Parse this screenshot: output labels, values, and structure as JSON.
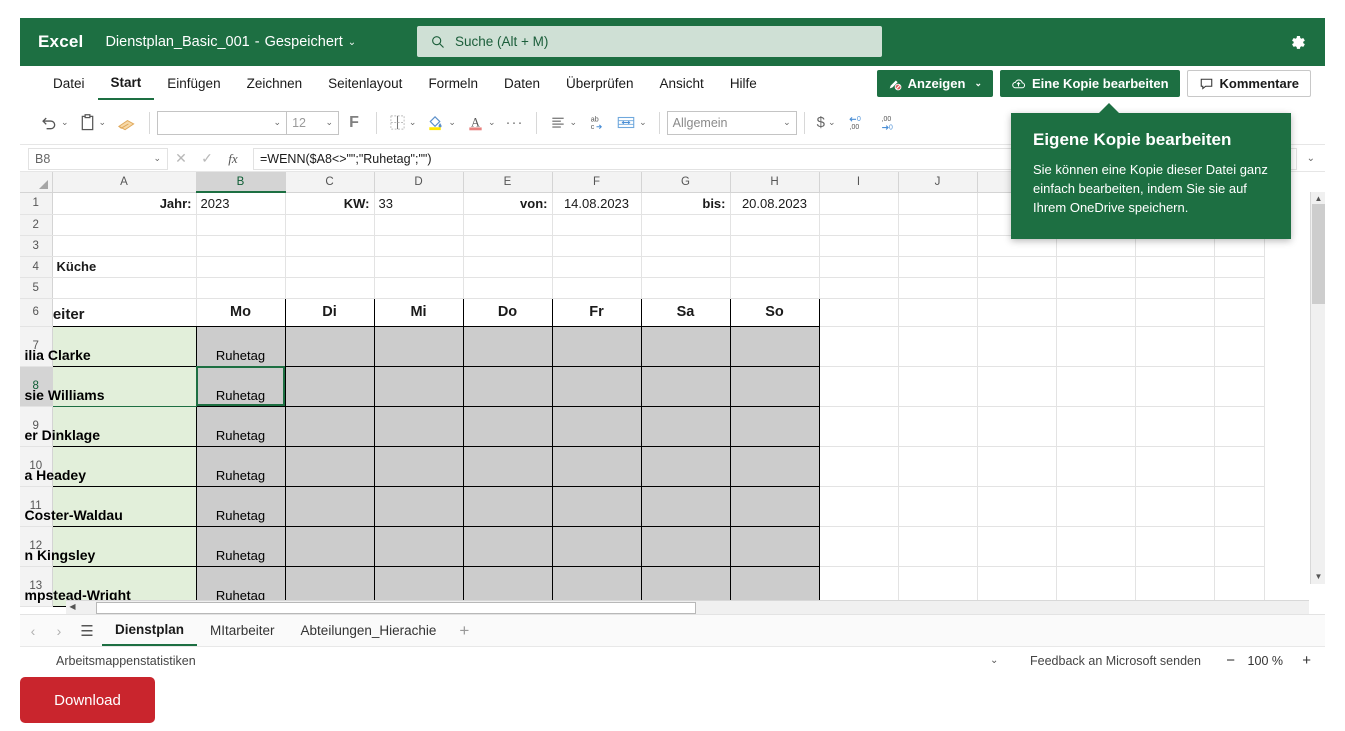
{
  "titlebar": {
    "logo": "Excel",
    "document": "Dienstplan_Basic_001",
    "separator": "-",
    "save_state": "Gespeichert",
    "chevron": "⌄",
    "search_placeholder": "Suche (Alt + M)",
    "search_icon": "search-icon",
    "settings_icon": "gear-icon"
  },
  "ribbon": {
    "tabs": [
      {
        "label": "Datei",
        "active": false
      },
      {
        "label": "Start",
        "active": true
      },
      {
        "label": "Einfügen",
        "active": false
      },
      {
        "label": "Zeichnen",
        "active": false
      },
      {
        "label": "Seitenlayout",
        "active": false
      },
      {
        "label": "Formeln",
        "active": false
      },
      {
        "label": "Daten",
        "active": false
      },
      {
        "label": "Überprüfen",
        "active": false
      },
      {
        "label": "Ansicht",
        "active": false
      },
      {
        "label": "Hilfe",
        "active": false
      }
    ],
    "view_button": "Anzeigen",
    "edit_copy_button": "Eine Kopie bearbeiten",
    "comments_button": "Kommentare"
  },
  "toolbar": {
    "font_value": "",
    "font_size": "12",
    "bold_label": "F",
    "number_format": "Allgemein",
    "currency_symbol": "$",
    "more_label": "···"
  },
  "formulabar": {
    "cell_reference": "B8",
    "cancel_icon": "cancel-icon",
    "confirm_icon": "confirm-icon",
    "fx_label": "fx",
    "formula": "=WENN($A8<>\"\";\"Ruhetag\";\"\")"
  },
  "grid": {
    "columns": [
      "A",
      "B",
      "C",
      "D",
      "E",
      "F",
      "G",
      "H",
      "I",
      "J"
    ],
    "selected_column": "B",
    "selected_row": "8",
    "rows": [
      {
        "num": "1",
        "cells": {
          "A": "Jahr:",
          "B": "2023",
          "C": "",
          "D": "KW:",
          "E": "33",
          "F": "",
          "G": "von:",
          "H": "14.08.2023",
          "I": "bis:",
          "J": "20.08.2023"
        }
      },
      {
        "num": "2",
        "cells": {}
      },
      {
        "num": "3",
        "cells": {}
      },
      {
        "num": "4",
        "cells": {
          "A": "Küche"
        }
      },
      {
        "num": "5",
        "cells": {}
      }
    ],
    "row1": {
      "label_jahr": "Jahr:",
      "value_jahr": "2023",
      "label_kw": "KW:",
      "value_kw": "33",
      "label_von": "von:",
      "value_von": "14.08.2023",
      "label_bis": "bis:",
      "value_bis": "20.08.2023"
    },
    "row4_label": "Küche",
    "header_row": {
      "num": "6",
      "employee_col": "tarbeiter",
      "days": [
        "Mo",
        "Di",
        "Mi",
        "Do",
        "Fr",
        "Sa",
        "So"
      ]
    },
    "employee_rows": [
      {
        "num": "7",
        "name": "ilia Clarke",
        "mo": "Ruhetag"
      },
      {
        "num": "8",
        "name": "sie Williams",
        "mo": "Ruhetag"
      },
      {
        "num": "9",
        "name": "er Dinklage",
        "mo": "Ruhetag"
      },
      {
        "num": "10",
        "name": "a Headey",
        "mo": "Ruhetag"
      },
      {
        "num": "11",
        "name": "Coster-Waldau",
        "mo": "Ruhetag"
      },
      {
        "num": "12",
        "name": "n Kingsley",
        "mo": "Ruhetag"
      },
      {
        "num": "13",
        "name": "mpstead-Wright",
        "mo": "Ruhetag"
      }
    ]
  },
  "sheettabs": {
    "prev_icon": "chevron-left-icon",
    "next_icon": "chevron-right-icon",
    "list_icon": "sheet-list-icon",
    "tabs": [
      {
        "label": "Dienstplan",
        "active": true
      },
      {
        "label": "MItarbeiter",
        "active": false
      },
      {
        "label": "Abteilungen_Hierachie",
        "active": false
      }
    ],
    "add_label": "+"
  },
  "statusbar": {
    "workbook_stats": "Arbeitsmappenstatistiken",
    "feedback": "Feedback an Microsoft senden",
    "zoom_out": "−",
    "zoom_level": "100 %",
    "zoom_in": "+"
  },
  "tooltip": {
    "title": "Eigene Kopie bearbeiten",
    "body": "Sie können eine Kopie dieser Datei ganz einfach bearbeiten, indem Sie sie auf Ihrem OneDrive speichern."
  },
  "download": {
    "label": "Download"
  },
  "colors": {
    "excel_green": "#1d6f42",
    "name_fill": "#e2efda",
    "shift_fill": "#cccccc",
    "download_red": "#c9252d"
  }
}
